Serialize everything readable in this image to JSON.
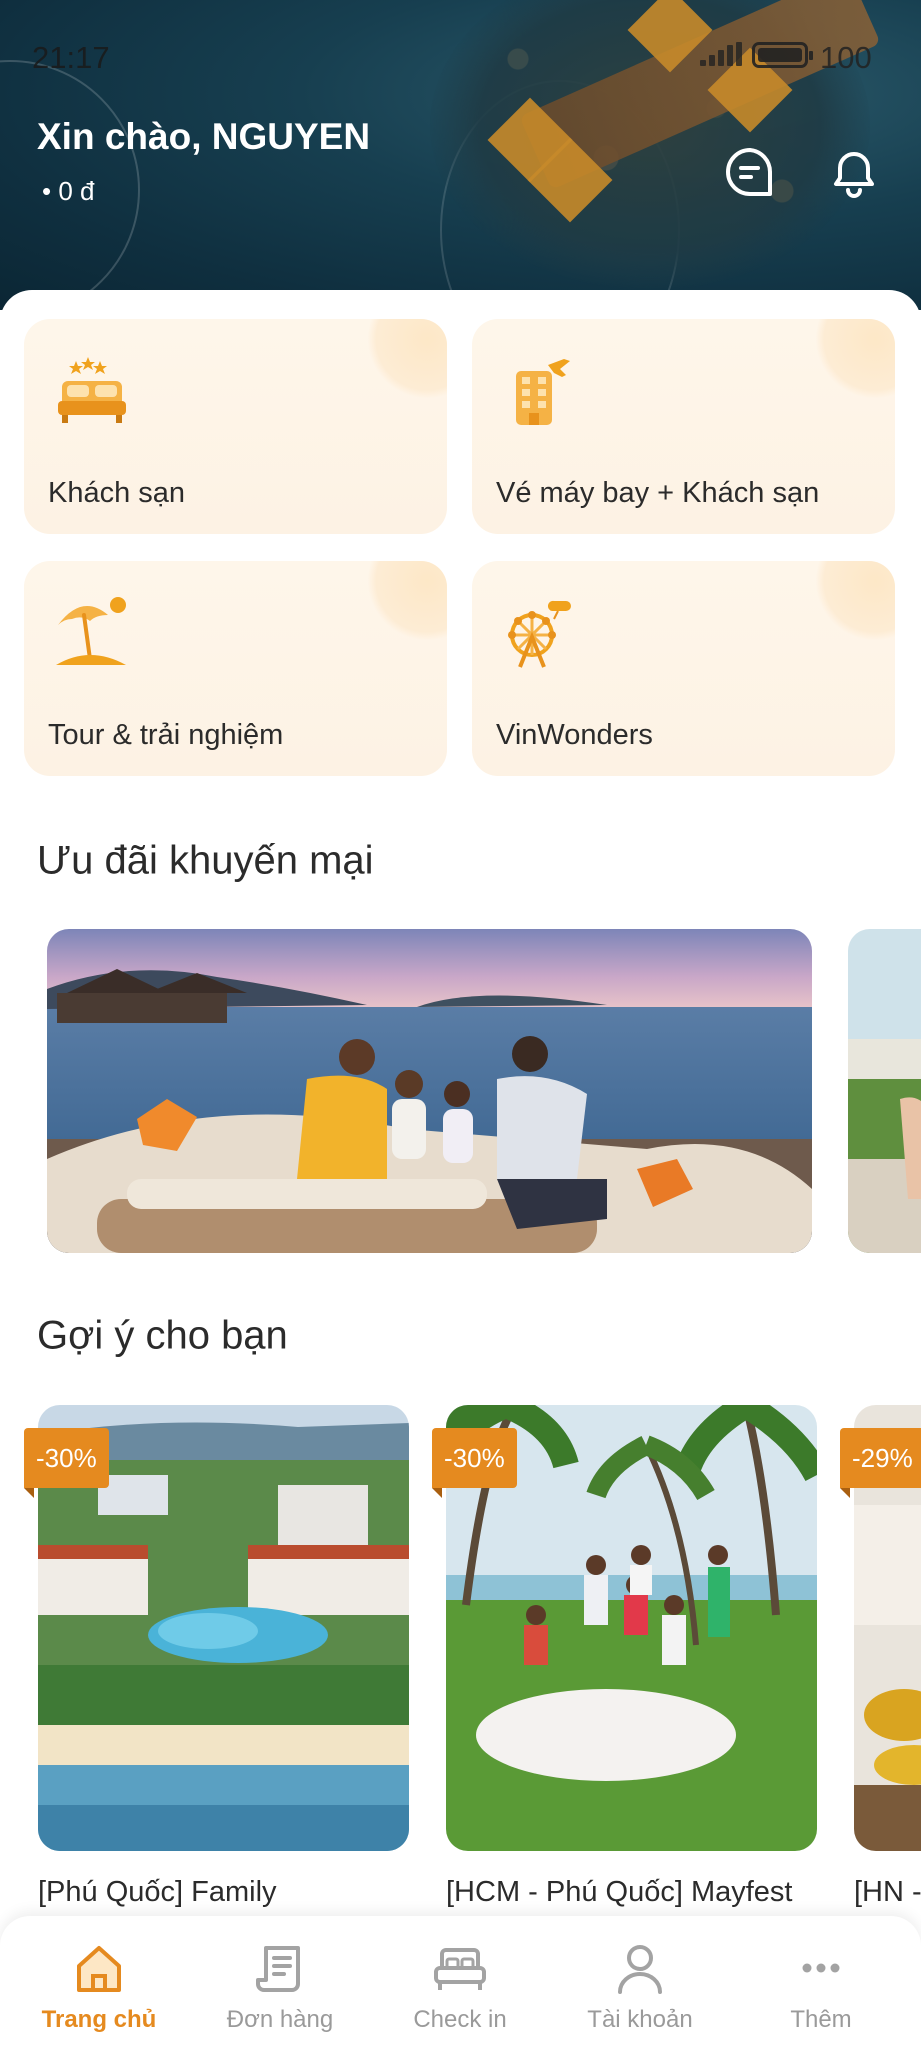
{
  "status_bar": {
    "time": "21:17",
    "battery": "100"
  },
  "header": {
    "greeting": "Xin chào, NGUYEN",
    "balance": "• 0 đ"
  },
  "services": [
    {
      "label": "Khách sạn",
      "icon": "hotel-bed-icon"
    },
    {
      "label": "Vé máy bay + Khách sạn",
      "icon": "flight-hotel-icon"
    },
    {
      "label": "Tour & trải nghiệm",
      "icon": "beach-umbrella-icon"
    },
    {
      "label": "VinWonders",
      "icon": "ferris-wheel-icon"
    }
  ],
  "promotions": {
    "title": "Ưu đãi khuyến mại"
  },
  "suggestions": {
    "title": "Gợi ý cho bạn",
    "items": [
      {
        "discount": "-30%",
        "title": "[Phú Quốc] Family"
      },
      {
        "discount": "-30%",
        "title": "[HCM - Phú Quốc] Mayfest"
      },
      {
        "discount": "-29%",
        "title": "[HN -"
      }
    ]
  },
  "nav": {
    "items": [
      {
        "label": "Trang chủ",
        "icon": "home-icon",
        "active": true
      },
      {
        "label": "Đơn hàng",
        "icon": "orders-icon",
        "active": false
      },
      {
        "label": "Check in",
        "icon": "check-in-bed-icon",
        "active": false
      },
      {
        "label": "Tài khoản",
        "icon": "account-icon",
        "active": false
      },
      {
        "label": "Thêm",
        "icon": "more-icon",
        "active": false
      }
    ]
  },
  "colors": {
    "accent": "#e58a1f",
    "header_bg": "#173f50",
    "card_bg": "#fef6ea",
    "nav_inactive": "#9a9a9a"
  }
}
